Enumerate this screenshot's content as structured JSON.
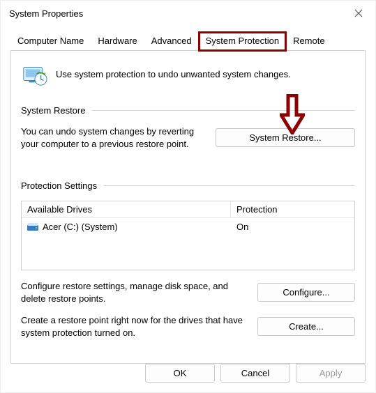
{
  "window": {
    "title": "System Properties"
  },
  "tabs": {
    "computer_name": "Computer Name",
    "hardware": "Hardware",
    "advanced": "Advanced",
    "system_protection": "System Protection",
    "remote": "Remote"
  },
  "intro": "Use system protection to undo unwanted system changes.",
  "system_restore": {
    "title": "System Restore",
    "desc": "You can undo system changes by reverting your computer to a previous restore point.",
    "button": "System Restore..."
  },
  "protection_settings": {
    "title": "Protection Settings",
    "col_drives": "Available Drives",
    "col_protection": "Protection",
    "rows": [
      {
        "name": "Acer (C:) (System)",
        "protection": "On"
      }
    ],
    "configure_desc": "Configure restore settings, manage disk space, and delete restore points.",
    "configure_btn": "Configure...",
    "create_desc": "Create a restore point right now for the drives that have system protection turned on.",
    "create_btn": "Create..."
  },
  "footer": {
    "ok": "OK",
    "cancel": "Cancel",
    "apply": "Apply"
  }
}
